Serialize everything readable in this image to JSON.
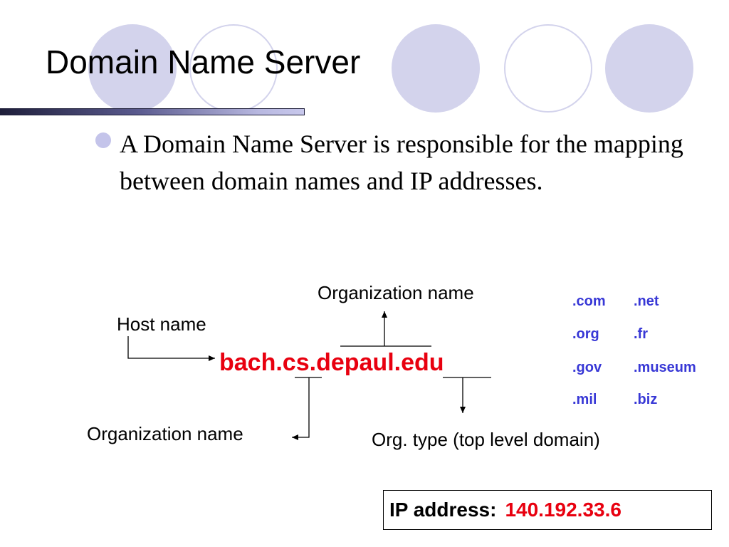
{
  "slide": {
    "title": "Domain Name Server",
    "bullet": "A Domain Name Server is responsible for the mapping between domain names and IP addresses."
  },
  "diagram": {
    "domain": "bach.cs.depaul.edu",
    "host_label": "Host name",
    "org_label_top": "Organization name",
    "org_label_bottom": "Organization name",
    "tld_label": "Org. type (top level domain)"
  },
  "tld_list": [
    [
      ".com",
      ".net"
    ],
    [
      ".org",
      ".fr"
    ],
    [
      ".gov",
      ".museum"
    ],
    [
      ".mil",
      ".biz"
    ]
  ],
  "ip": {
    "label": "IP address:",
    "value": "140.192.33.6"
  },
  "colors": {
    "accent_red": "#e8000f",
    "tld_blue": "#3838d6",
    "circle_lavender": "#d3d3ec"
  }
}
